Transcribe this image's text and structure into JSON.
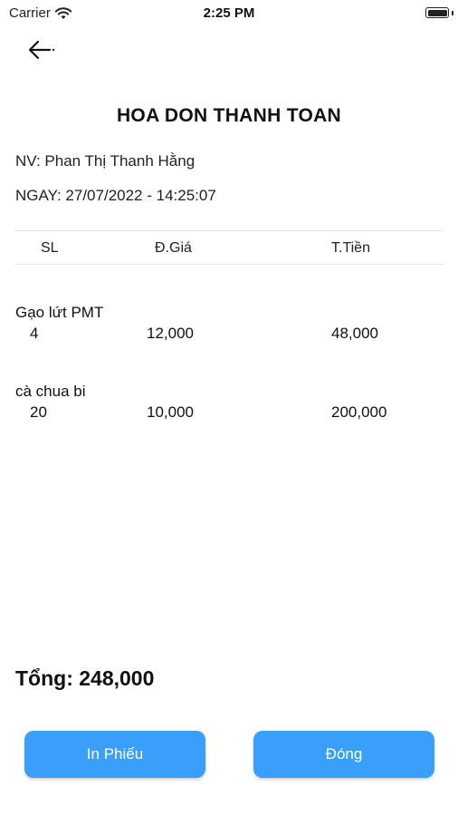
{
  "status_bar": {
    "carrier": "Carrier",
    "time": "2:25 PM",
    "wifi_icon": "wifi-icon",
    "battery_icon": "battery-icon"
  },
  "header": {
    "back_icon": "arrow-left-icon"
  },
  "title": "HOA DON THANH TOAN",
  "staff_line": "NV: Phan Thị Thanh Hằng",
  "date_line": "NGAY: 27/07/2022 - 14:25:07",
  "table": {
    "columns": [
      "SL",
      "Đ.Giá",
      "T.Tiền"
    ],
    "items": [
      {
        "name": "Gạo lứt PMT",
        "qty": "4",
        "price": "12,000",
        "total": "48,000"
      },
      {
        "name": "cà chua bi",
        "qty": "20",
        "price": "10,000",
        "total": "200,000"
      }
    ]
  },
  "total_line": "Tổng: 248,000",
  "buttons": {
    "print": "In Phiếu",
    "close": "Đóng"
  },
  "colors": {
    "accent": "#3a9ffa",
    "text": "#111111"
  }
}
